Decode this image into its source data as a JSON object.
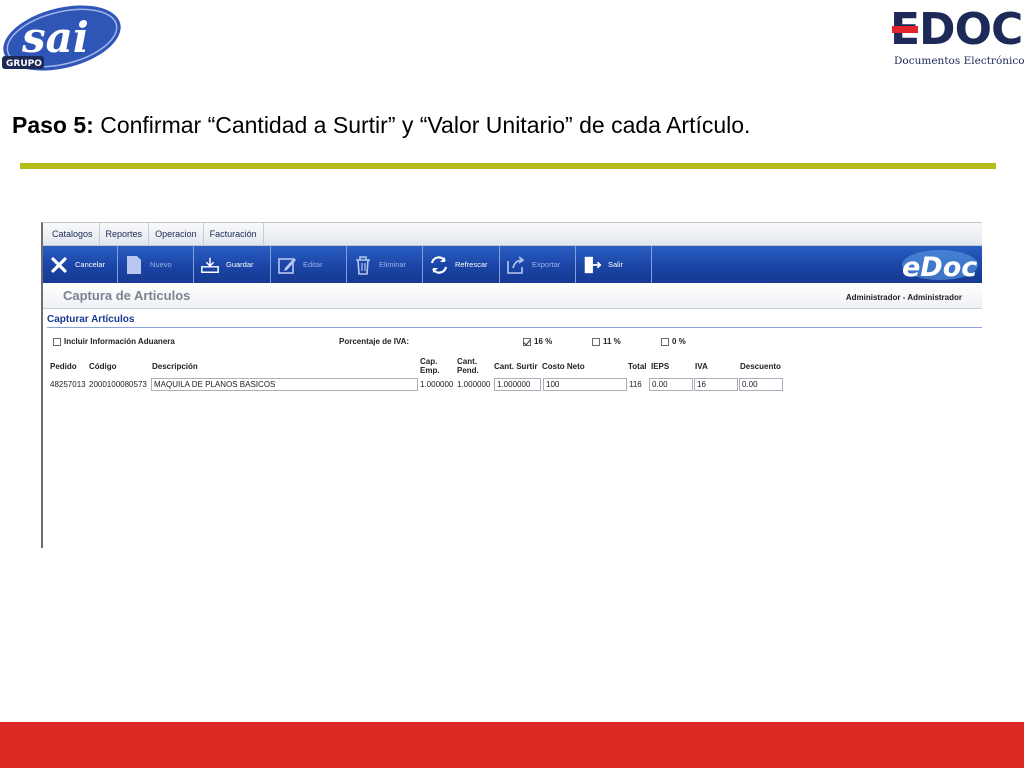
{
  "slide": {
    "title_bold": "Paso 5:",
    "title_rest": " Confirmar “Cantidad a Surtir” y “Valor Unitario” de cada Artículo.",
    "logo_left": {
      "big": "sai",
      "small": "GRUPO"
    },
    "logo_right": {
      "word": "EDOC",
      "subtitle": "Documentos Electrónicos"
    },
    "colors": {
      "rule": "#b5bd1b",
      "footer": "#dc2a24",
      "navy": "#1d2a57"
    }
  },
  "app": {
    "menu": [
      "Catalogos",
      "Reportes",
      "Operacion",
      "Facturación"
    ],
    "toolbar": [
      {
        "label": "Cancelar",
        "icon": "close-icon",
        "enabled": true
      },
      {
        "label": "Nuevo",
        "icon": "document-icon",
        "enabled": false
      },
      {
        "label": "Guardar",
        "icon": "save-tray-icon",
        "enabled": true
      },
      {
        "label": "Editar",
        "icon": "edit-icon",
        "enabled": false
      },
      {
        "label": "Eliminar",
        "icon": "trash-icon",
        "enabled": false
      },
      {
        "label": "Refrescar",
        "icon": "refresh-icon",
        "enabled": true
      },
      {
        "label": "Exportar",
        "icon": "export-icon",
        "enabled": false
      },
      {
        "label": "Salir",
        "icon": "exit-door-icon",
        "enabled": true
      }
    ],
    "toolbar_logo": "eDoc",
    "page_title": "Captura de Articulos",
    "user": "Administrador - Administrador",
    "section_title": "Capturar Artículos",
    "options": {
      "aduanera_label": "Incluir Información Aduanera",
      "aduanera_checked": false,
      "iva_label": "Porcentaje de IVA:",
      "iva_options": [
        {
          "label": "16 %",
          "checked": true
        },
        {
          "label": "11 %",
          "checked": false
        },
        {
          "label": "0 %",
          "checked": false
        }
      ]
    },
    "columns": {
      "pedido": "Pedido",
      "codigo": "Código",
      "descripcion": "Descripción",
      "cap_emp_1": "Cap.",
      "cap_emp_2": "Emp.",
      "cant_pend_1": "Cant.",
      "cant_pend_2": "Pend.",
      "cant_surtir": "Cant. Surtir",
      "costo_neto": "Costo Neto",
      "total": "Total",
      "ieps": "IEPS",
      "iva": "IVA",
      "descuento": "Descuento"
    },
    "row": {
      "pedido": "48257013",
      "codigo": "2000100080573",
      "descripcion": "MAQUILA DE PLANOS BASICOS",
      "cap_emp": "1.000000",
      "cant_pend": "1.000000",
      "cant_surtir": "1.000000",
      "costo_neto": "100",
      "total": "116",
      "ieps": "0.00",
      "iva": "16",
      "descuento": "0.00"
    }
  }
}
